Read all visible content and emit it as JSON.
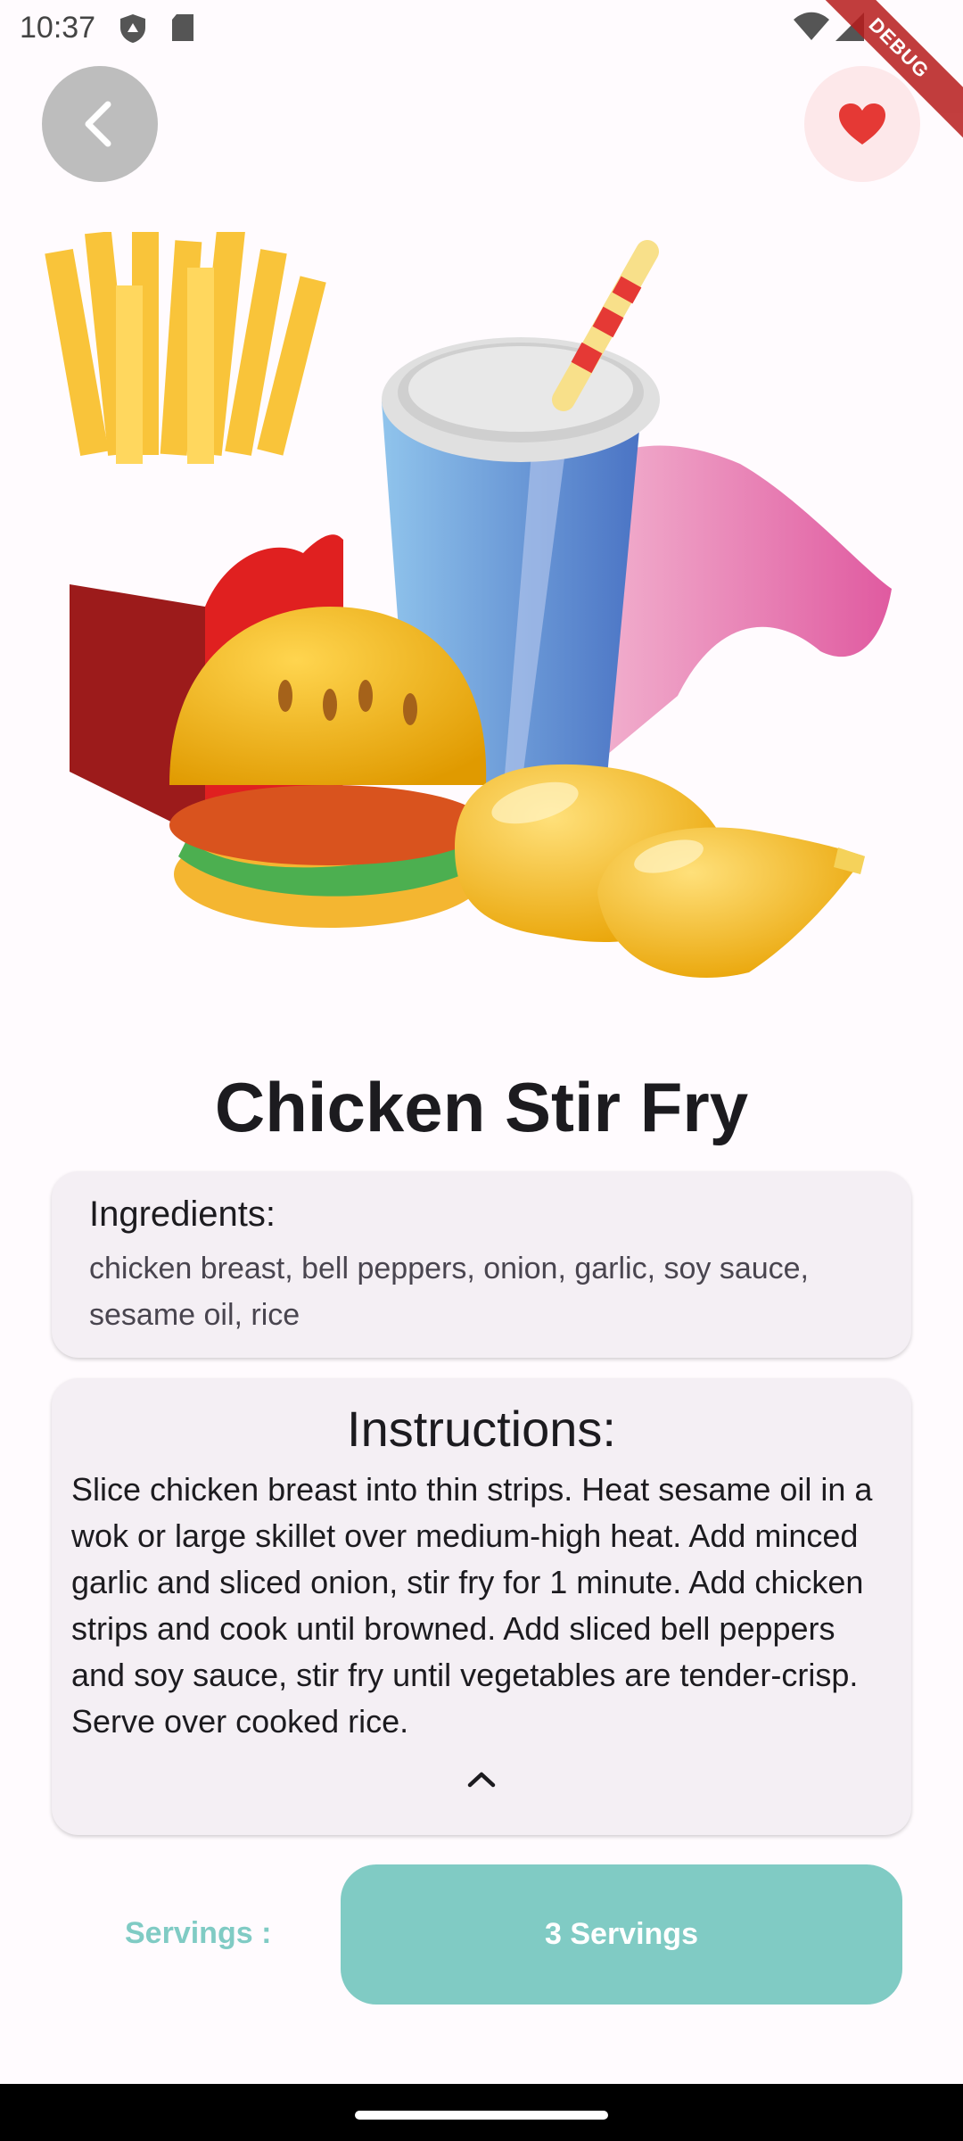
{
  "status_bar": {
    "time": "10:37",
    "icons": [
      "shield-icon",
      "sd-card-icon",
      "wifi-icon",
      "signal-icon"
    ]
  },
  "debug_banner": "DEBUG",
  "header": {
    "back_icon": "chevron-left-icon",
    "favorite_icon": "heart-icon"
  },
  "recipe": {
    "title": "Chicken Stir Fry",
    "ingredients_heading": "Ingredients:",
    "ingredients": "chicken breast, bell peppers, onion, garlic, soy sauce, sesame oil, rice",
    "instructions_heading": "Instructions:",
    "instructions": "Slice chicken breast into thin strips. Heat sesame oil in a wok or large skillet over medium-high heat. Add minced garlic and sliced onion, stir fry for 1 minute. Add chicken strips and cook until browned. Add sliced bell peppers and soy sauce, stir fry until vegetables are tender-crisp. Serve over cooked rice.",
    "collapse_icon": "chevron-up-icon"
  },
  "servings": {
    "label": "Servings :",
    "value": "3 Servings"
  },
  "colors": {
    "accent": "#80cbc4",
    "favorite": "#e53935",
    "card": "#f4eff4"
  }
}
